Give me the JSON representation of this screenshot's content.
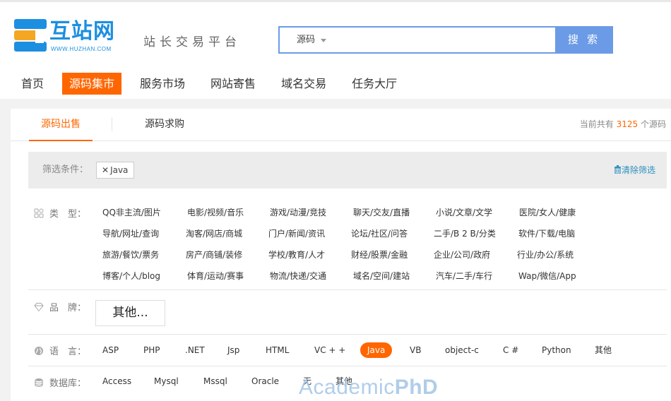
{
  "header": {
    "logo_text": "互站网",
    "logo_url_text": "WWW.HUZHAN.COM",
    "slogan": "站长交易平台"
  },
  "search": {
    "type_label": "源码",
    "value": "",
    "button_label": "搜 索"
  },
  "nav": {
    "items": [
      {
        "label": "首页"
      },
      {
        "label": "源码集市",
        "active": true
      },
      {
        "label": "服务市场"
      },
      {
        "label": "网站寄售"
      },
      {
        "label": "域名交易"
      },
      {
        "label": "任务大厅"
      }
    ]
  },
  "tabs": {
    "items": [
      {
        "label": "源码出售",
        "active": true
      },
      {
        "label": "源码求购"
      }
    ],
    "total_prefix": "当前共有",
    "total_count": "3125",
    "total_suffix": "个源码"
  },
  "filter": {
    "label": "筛选条件：",
    "tag": "Java",
    "clear_label": "清除筛选"
  },
  "type_row": {
    "label": "类　型：",
    "items": [
      [
        "QQ非主流/图片",
        "电影/视频/音乐",
        "游戏/动漫/竞技",
        "聊天/交友/直播",
        "小说/文章/文学",
        "医院/女人/健康"
      ],
      [
        "导航/网址/查询",
        "淘客/网店/商城",
        "门户/新闻/资讯",
        "论坛/社区/问答",
        "二手/B 2 B/分类",
        "软件/下载/电脑"
      ],
      [
        "旅游/餐饮/票务",
        "房产/商铺/装修",
        "学校/教育/人才",
        "财经/股票/金融",
        "企业/公司/政府",
        "行业/办公/系统"
      ],
      [
        "博客/个人/blog",
        "体育/运动/赛事",
        "物流/快递/交通",
        "域名/空间/建站",
        "汽车/二手/车行",
        "Wap/微信/App"
      ]
    ]
  },
  "brand_row": {
    "label": "品　牌：",
    "value": "其他..."
  },
  "language_row": {
    "label": "语　言：",
    "options": [
      "ASP",
      "PHP",
      ".NET",
      "Jsp",
      "HTML",
      "VC + +",
      "Java",
      "VB",
      "object-c",
      "C #",
      "Python",
      "其他"
    ],
    "selected": "Java"
  },
  "database_row": {
    "label": "数据库：",
    "options": [
      "Access",
      "Mysql",
      "Mssql",
      "Oracle",
      "无",
      "其他"
    ]
  },
  "watermark": {
    "part1": "Academic",
    "part2": "PhD"
  },
  "colors": {
    "accent": "#ff6600",
    "search_blue": "#6b9be6",
    "link_blue": "#2a8fbd"
  }
}
